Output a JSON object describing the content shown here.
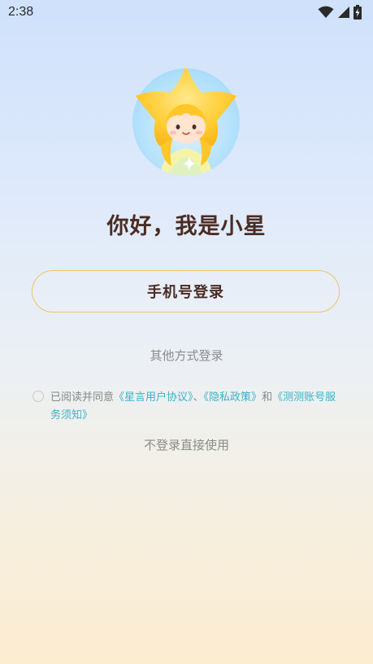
{
  "status_bar": {
    "time": "2:38",
    "icons": [
      "wifi-icon",
      "signal-icon",
      "battery-charging-icon"
    ]
  },
  "avatar": {
    "icon": "star-mascot-avatar"
  },
  "greeting": "你好，我是小星",
  "buttons": {
    "phone_login": "手机号登录"
  },
  "other_login": "其他方式登录",
  "agreement": {
    "prefix": "已阅读并同意",
    "link_user_agreement": "《星言用户协议》",
    "sep1": "、",
    "link_privacy": "《隐私政策》",
    "sep2": "和",
    "link_account": "《测测账号服务须知》"
  },
  "no_login": "不登录直接使用",
  "colors": {
    "title": "#4a2c24",
    "link": "#3bb3c7",
    "button_border": "#e8c56a",
    "muted_text": "#8b8b8b"
  }
}
